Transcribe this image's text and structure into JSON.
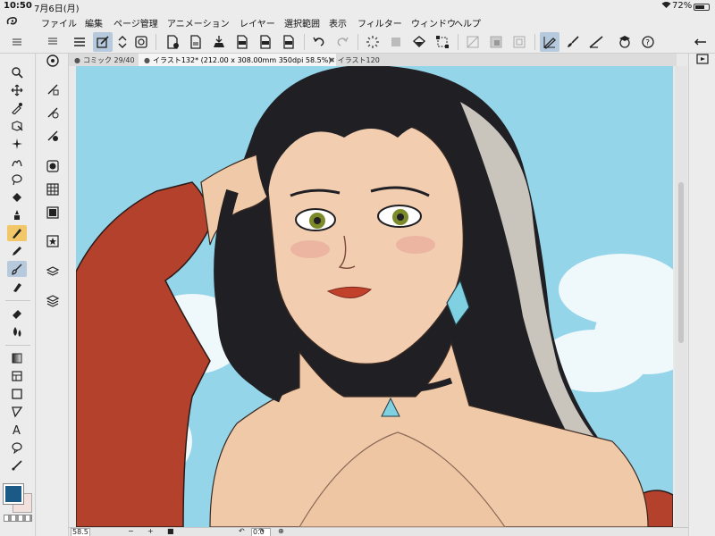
{
  "status": {
    "time": "10:50",
    "date": "7月6日(月)",
    "battery_pct": "72%",
    "battery_level": 0.72
  },
  "menu": {
    "items": [
      "ファイル",
      "編集",
      "ページ管理",
      "アニメーション",
      "レイヤー",
      "選択範囲",
      "表示",
      "フィルター",
      "ウィンドウ",
      "ヘルプ"
    ]
  },
  "tabs": [
    {
      "label": "コミック 29/40",
      "active": false
    },
    {
      "label": "イラスト132* (212.00 x 308.00mm 350dpi 58.5%)",
      "active": true
    },
    {
      "label": "イラスト120",
      "active": false
    }
  ],
  "bottom": {
    "zoom": "58.5",
    "rotation": "0.0"
  },
  "colors": {
    "main": "#1b5a86",
    "sub": "#f2e0dd",
    "accent_selected": "#b7c9dd",
    "tool_selected": "#f1c76a",
    "sky": "#95d5ea"
  },
  "toolbar_icons": [
    "hamburger-icon",
    "transform-icon",
    "spinner-icon",
    "canvas-icon",
    "new-file-icon",
    "save-icon",
    "export-icon",
    "jpg-icon",
    "png-icon",
    "psd-icon",
    "undo-icon",
    "redo-icon",
    "loading-icon",
    "clear-icon",
    "fill-icon",
    "transform-selection-icon",
    "unselect-icon",
    "invert-icon",
    "select-all-icon",
    "pen-mode-icon",
    "brush-icon",
    "line-icon",
    "assist-icon",
    "help-icon"
  ],
  "tool_icons": [
    "zoom-icon",
    "move-icon",
    "move-layer-icon",
    "eyedropper-icon",
    "object-icon",
    "auto-select-icon",
    "marquee-icon",
    "lasso-icon",
    "fill-bucket-icon",
    "ink-icon",
    "pen-icon",
    "pencil-icon",
    "brush-icon",
    "airbrush-icon",
    "eraser-icon",
    "blend-icon",
    "gradient-icon",
    "frame-icon",
    "shape-icon",
    "ruler-icon",
    "text-icon",
    "balloon-icon",
    "correct-line-icon"
  ]
}
